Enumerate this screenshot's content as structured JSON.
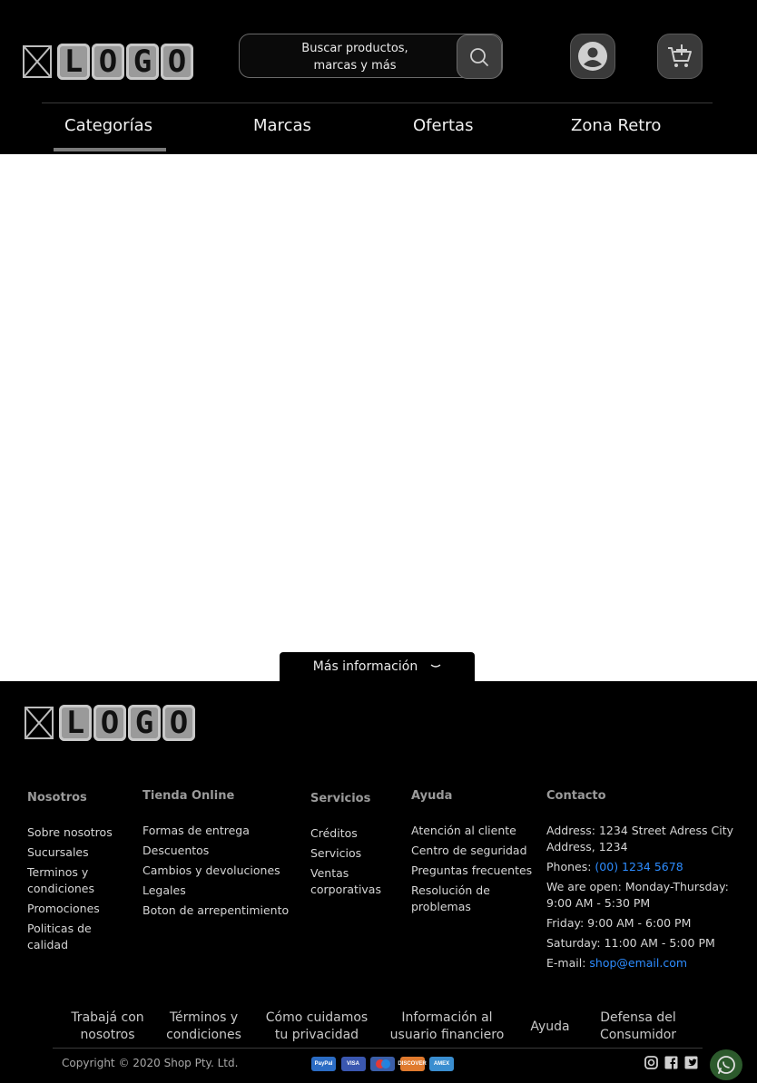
{
  "header": {
    "logo_text": [
      "L",
      "O",
      "G",
      "O"
    ],
    "search": {
      "placeholder": "Buscar productos, marcas y más"
    },
    "icons": [
      "search-icon",
      "user-icon",
      "cart-add-icon"
    ]
  },
  "nav": {
    "items": [
      {
        "label": "Categorías",
        "active": true
      },
      {
        "label": "Marcas"
      },
      {
        "label": "Ofertas"
      },
      {
        "label": "Zona Retro"
      }
    ]
  },
  "more_info": {
    "label": "Más información",
    "icon": "chevron-down-icon"
  },
  "footer": {
    "logo_text": [
      "L",
      "O",
      "G",
      "O"
    ],
    "columns": [
      {
        "title": "Nosotros",
        "items": [
          "Sobre nosotros",
          "Sucursales",
          "Terminos y condiciones",
          "Promociones",
          "Politicas de calidad"
        ]
      },
      {
        "title": "Tienda Online",
        "items": [
          "Formas de entrega",
          "Descuentos",
          "Cambios y devoluciones",
          "Legales",
          "Boton de arrepentimiento"
        ]
      },
      {
        "title": "Servicios",
        "items": [
          "Créditos",
          "Servicios",
          "Ventas corporativas"
        ]
      },
      {
        "title": "Ayuda",
        "items": [
          "Atención al cliente",
          "Centro de seguridad",
          "Preguntas frecuentes",
          "Resolución de problemas"
        ]
      }
    ],
    "contact": {
      "title": "Contacto",
      "address": "Address: 1234 Street Adress City Address, 1234",
      "phones_label": "Phones: ",
      "phones_value": "(00) 1234 5678",
      "open_weekdays": "We are open: Monday-Thursday: 9:00 AM - 5:30 PM",
      "friday": "Friday: 9:00 AM - 6:00 PM",
      "saturday": "Saturday: 11:00 AM - 5:00 PM",
      "email_label": "E-mail: ",
      "email_value": "shop@email.com"
    },
    "bottom_links": [
      "Trabajá con nosotros",
      "Términos y condiciones",
      "Cómo cuidamos tu privacidad",
      "Información al usuario financiero",
      "Ayuda",
      "Defensa del Consumidor"
    ],
    "copyright": "Copyright © 2020 Shop Pty. Ltd.",
    "payments": [
      {
        "name": "PayPal",
        "color": "#2b6cc4"
      },
      {
        "name": "VISA",
        "color": "#3a57b0"
      },
      {
        "name": "maestro",
        "color": "#3b5ea8"
      },
      {
        "name": "DISCOVER",
        "color": "#e07a2e"
      },
      {
        "name": "AMEX",
        "color": "#3a8ed0"
      }
    ],
    "socials": [
      "instagram-icon",
      "facebook-icon",
      "twitter-icon"
    ],
    "chat_icon": "whatsapp-icon",
    "colors": {
      "link": "#2d8cff",
      "background": "#000000"
    }
  }
}
